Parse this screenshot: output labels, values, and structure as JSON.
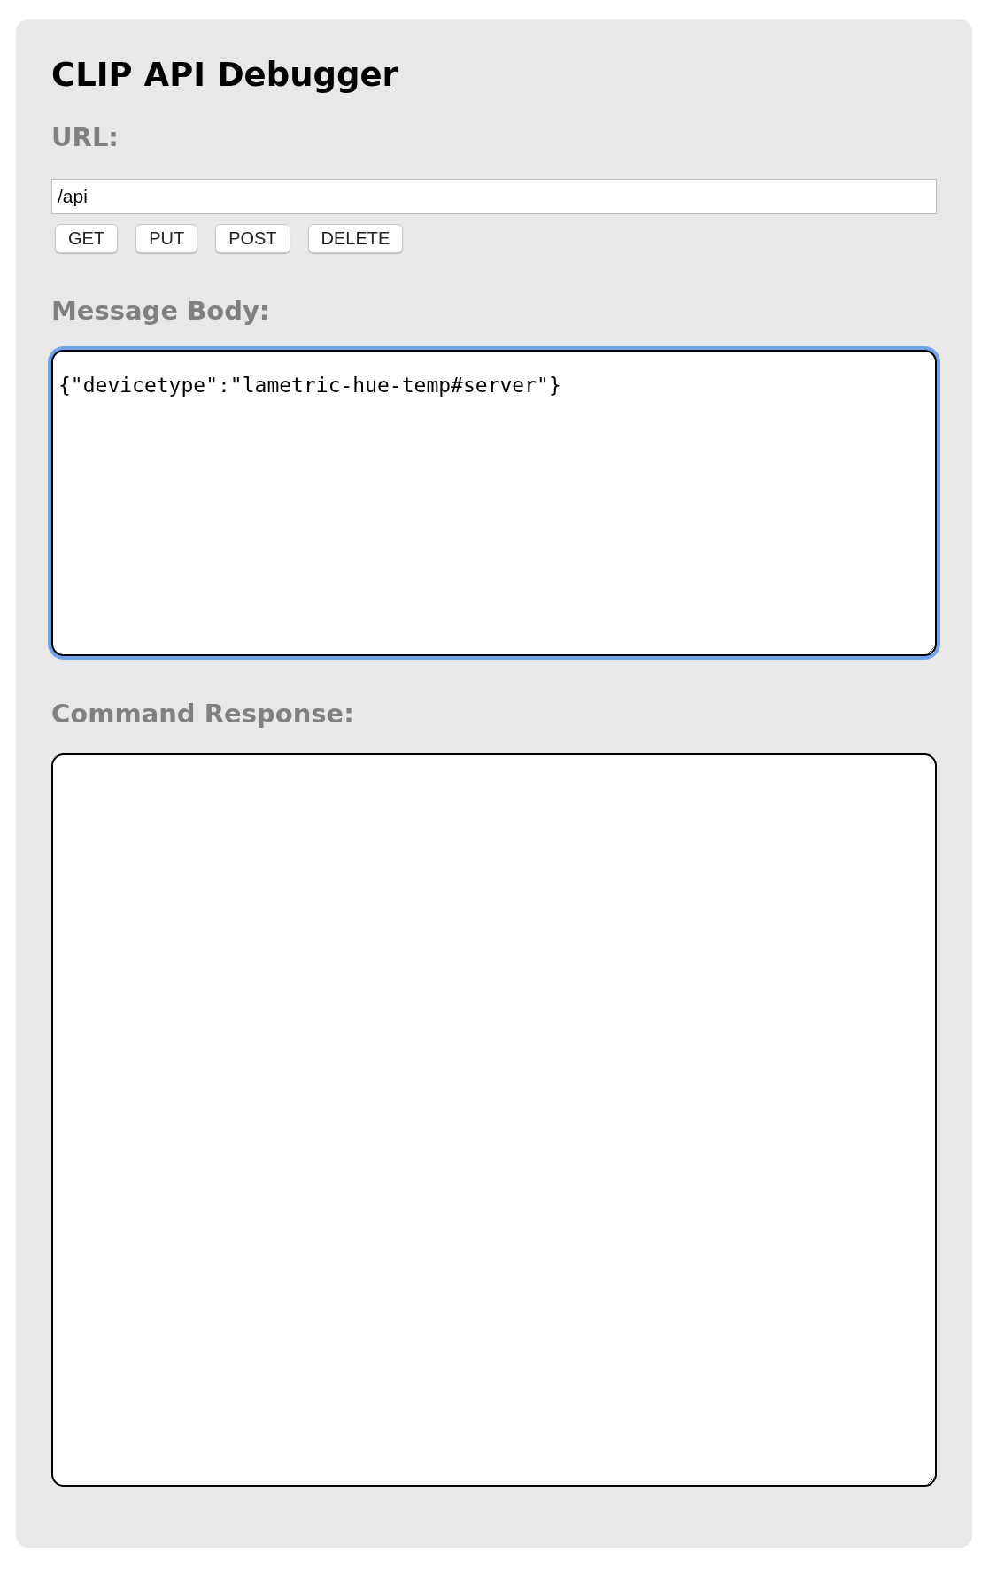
{
  "title": "CLIP API Debugger",
  "url": {
    "label": "URL:",
    "value": "/api"
  },
  "methods": [
    "GET",
    "PUT",
    "POST",
    "DELETE"
  ],
  "message_body": {
    "label": "Message Body:",
    "value": "{\"devicetype\":\"lametric-hue-temp#server\"}",
    "focused": true
  },
  "command_response": {
    "label": "Command Response:",
    "focused": false
  }
}
